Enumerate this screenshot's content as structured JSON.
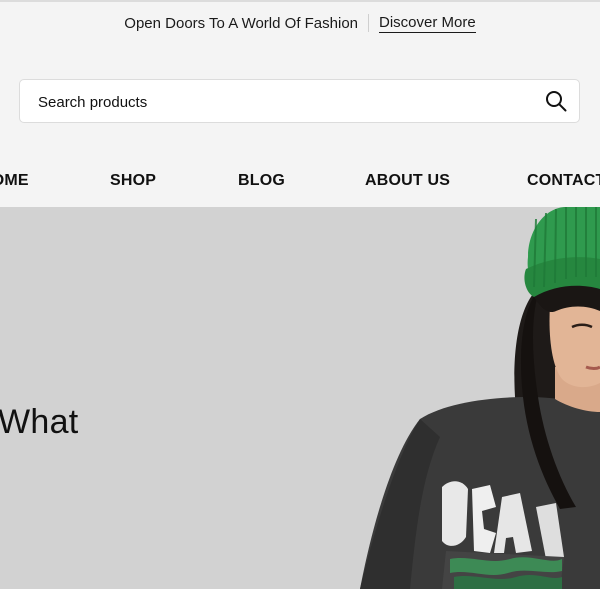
{
  "announcement": {
    "text": "Open Doors To A World Of Fashion",
    "link_label": "Discover More"
  },
  "search": {
    "placeholder": "Search products",
    "icon": "search-icon"
  },
  "nav": {
    "items": [
      {
        "label": "HOME"
      },
      {
        "label": "SHOP"
      },
      {
        "label": "BLOG"
      },
      {
        "label": "ABOUT US"
      },
      {
        "label": "CONTACT"
      }
    ]
  },
  "hero": {
    "heading": "What",
    "background": "#d2d2d2",
    "image_subject": "model-green-beanie-graphic-tee"
  },
  "colors": {
    "page_bg": "#f4f4f4",
    "beanie_green": "#2f9a4e",
    "shirt_dark": "#3a3a3a"
  }
}
